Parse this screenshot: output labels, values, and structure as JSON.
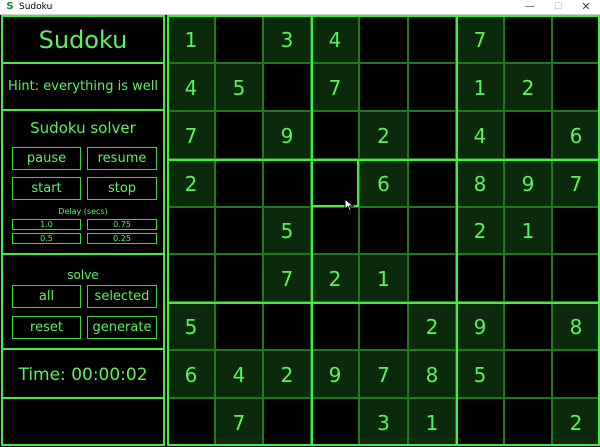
{
  "window": {
    "title": "Sudoku",
    "icon": "sudoku-app-icon",
    "controls": {
      "minimize": "—",
      "maximize": "☐",
      "close": "✕"
    }
  },
  "side": {
    "heading": "Sudoku",
    "hint": "Hint: everything is well",
    "solver_title": "Sudoku solver",
    "buttons": {
      "pause": "pause",
      "resume": "resume",
      "start": "start",
      "stop": "stop"
    },
    "delay_label": "Delay (secs)",
    "delays": [
      "1.0",
      "0.75",
      "0.5",
      "0.25"
    ],
    "solve_label": "solve",
    "solve_buttons": {
      "all": "all",
      "selected": "selected",
      "reset": "reset",
      "generate": "generate"
    },
    "timer": "Time: 00:00:02"
  },
  "board": {
    "rows": [
      [
        "1",
        "",
        "3",
        "4",
        "",
        "",
        "7",
        "",
        ""
      ],
      [
        "4",
        "5",
        "",
        "7",
        "",
        "",
        "1",
        "2",
        ""
      ],
      [
        "7",
        "",
        "9",
        "",
        "2",
        "",
        "4",
        "",
        "6"
      ],
      [
        "2",
        "",
        "",
        "",
        "6",
        "",
        "8",
        "9",
        "7"
      ],
      [
        "",
        "",
        "5",
        "",
        "",
        "",
        "2",
        "1",
        ""
      ],
      [
        "",
        "",
        "7",
        "2",
        "1",
        "",
        "",
        "",
        ""
      ],
      [
        "5",
        "",
        "",
        "",
        "",
        "2",
        "9",
        "",
        "8"
      ],
      [
        "6",
        "4",
        "2",
        "9",
        "7",
        "8",
        "5",
        "",
        ""
      ],
      [
        "",
        "7",
        "",
        "",
        "3",
        "1",
        "",
        "",
        "2"
      ]
    ],
    "selected_cell": [
      3,
      3
    ]
  },
  "colors": {
    "accent": "#3cf03c",
    "text": "#5ef05e",
    "grid": "#1f7a1f",
    "filled_bg": "#0b2a0b",
    "background": "#000000"
  }
}
